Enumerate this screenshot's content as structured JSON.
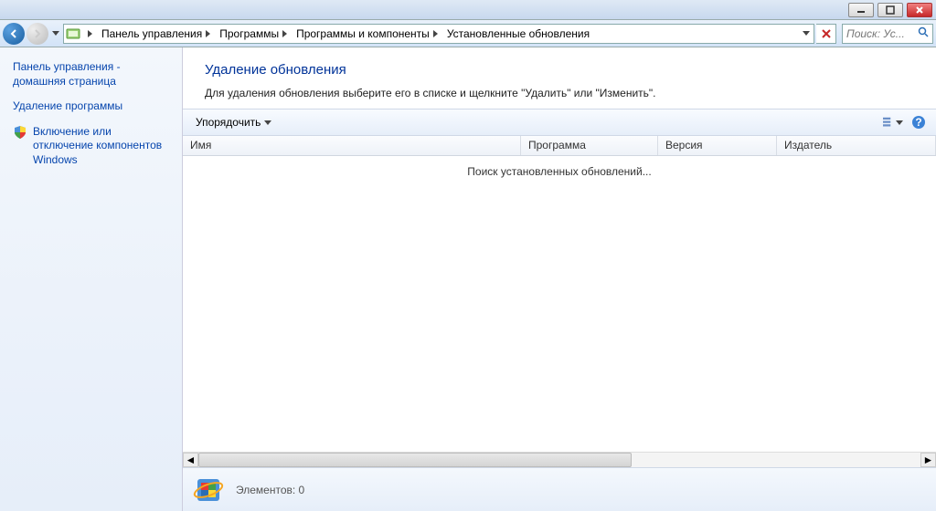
{
  "titlebar": {},
  "breadcrumb": {
    "items": [
      {
        "label": "Панель управления"
      },
      {
        "label": "Программы"
      },
      {
        "label": "Программы и компоненты"
      },
      {
        "label": "Установленные обновления"
      }
    ]
  },
  "search": {
    "placeholder": "Поиск: Ус..."
  },
  "sidebar": {
    "home": "Панель управления - домашняя страница",
    "uninstall": "Удаление программы",
    "features": "Включение или отключение компонентов Windows"
  },
  "header": {
    "title": "Удаление обновления",
    "subtitle": "Для удаления обновления выберите его в списке и щелкните \"Удалить\" или \"Изменить\"."
  },
  "toolbar": {
    "organize": "Упорядочить"
  },
  "columns": {
    "name": "Имя",
    "program": "Программа",
    "version": "Версия",
    "publisher": "Издатель"
  },
  "list": {
    "searching": "Поиск установленных обновлений..."
  },
  "status": {
    "count_label": "Элементов: 0"
  }
}
